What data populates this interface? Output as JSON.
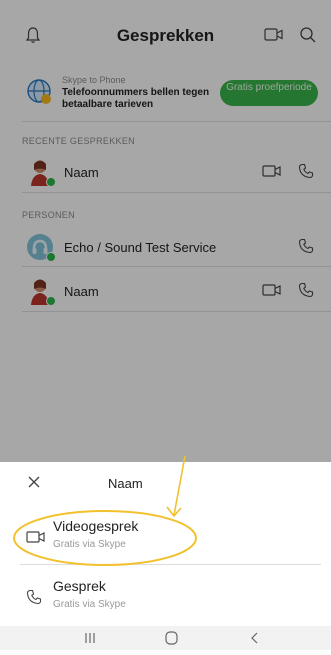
{
  "header": {
    "title": "Gesprekken",
    "icons": [
      "bell-icon",
      "video-camera-icon",
      "search-icon"
    ]
  },
  "promo": {
    "subtitle": "Skype to Phone",
    "text": "Telefoonnummers bellen tegen betaalbare tarieven",
    "button": "Gratis proefperiode",
    "colors": {
      "button": "#38b14a"
    }
  },
  "recent": {
    "heading": "RECENTE GESPREKKEN",
    "items": [
      {
        "name": "Naam",
        "online": true
      }
    ]
  },
  "people": {
    "heading": "PERSONEN",
    "items": [
      {
        "name": "Echo / Sound Test Service",
        "online": true
      },
      {
        "name": "Naam",
        "online": true
      }
    ]
  },
  "sheet": {
    "title": "Naam",
    "options": [
      {
        "title": "Videogesprek",
        "subtitle": "Gratis via Skype",
        "icon": "video-camera-icon"
      },
      {
        "title": "Gesprek",
        "subtitle": "Gratis via Skype",
        "icon": "phone-icon"
      }
    ]
  },
  "navbar": {
    "icons": [
      "recent-apps-icon",
      "home-icon",
      "back-icon"
    ]
  },
  "annotation": {
    "color": "#f2c12e"
  }
}
